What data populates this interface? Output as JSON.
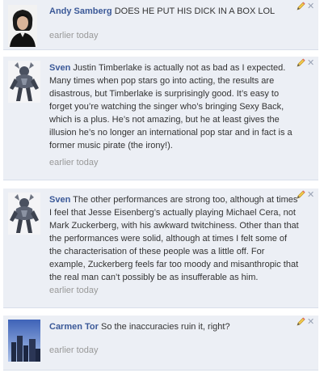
{
  "comments": [
    {
      "author": "Andy Samberg",
      "text": "DOES HE PUT HIS DICK IN A BOX LOL",
      "time": "earlier today",
      "avatar_icon": "person-photo-icon"
    },
    {
      "author": "Sven",
      "text": "Justin Timberlake is actually not as bad as I expected. Many times when pop stars go into acting, the results are disastrous, but Timberlake is surprisingly good. It’s easy to forget you’re watching the singer who’s bringing Sexy Back, which is a plus. He’s not amazing, but he at least gives the illusion he’s no longer an international pop star and in fact is a former music pirate (the irony!).",
      "time": "earlier today",
      "avatar_icon": "robot-figure-icon"
    },
    {
      "author": "Sven",
      "text": "The other performances are strong too, although at times I feel that Jesse Eisenberg’s actually playing Michael Cera, not Mark Zuckerberg, with his awkward twitchiness. Other than that the performances were solid, although at times I felt some of the characterisation of these people was a little off. For example, Zuckerberg feels far too moody and misanthropic that the real man can’t possibly be as insufferable as him.",
      "time": "earlier today",
      "avatar_icon": "robot-figure-icon"
    },
    {
      "author": "Carmen Tor",
      "text": "So the inaccuracies ruin it, right?",
      "time": "earlier today",
      "avatar_icon": "city-skyline-icon"
    }
  ],
  "colors": {
    "post_background": "#eceff5",
    "author_link": "#3b5998",
    "timestamp": "#999999"
  },
  "icons": {
    "edit": "pencil-icon",
    "delete": "close-icon"
  }
}
